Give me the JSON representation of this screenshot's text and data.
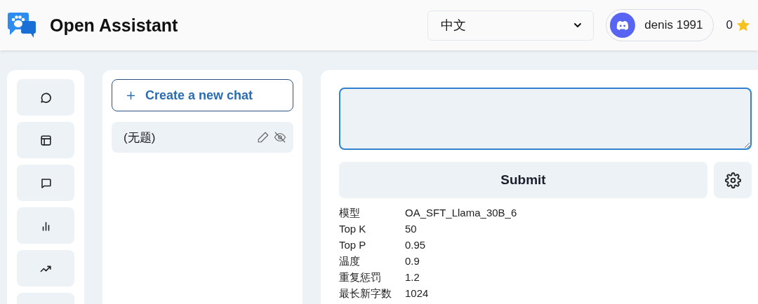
{
  "header": {
    "title": "Open Assistant",
    "language": "中文",
    "user": "denis 1991",
    "score": "0"
  },
  "chat_list": {
    "new_chat_button": "Create a new chat",
    "items": [
      {
        "title": "(无题)"
      }
    ]
  },
  "submit_button": "Submit",
  "settings": [
    {
      "label": "模型",
      "value": "OA_SFT_Llama_30B_6"
    },
    {
      "label": "Top K",
      "value": "50"
    },
    {
      "label": "Top P",
      "value": "0.95"
    },
    {
      "label": "温度",
      "value": "0.9"
    },
    {
      "label": "重复惩罚",
      "value": "1.2"
    },
    {
      "label": "最长新字数",
      "value": "1024"
    }
  ]
}
